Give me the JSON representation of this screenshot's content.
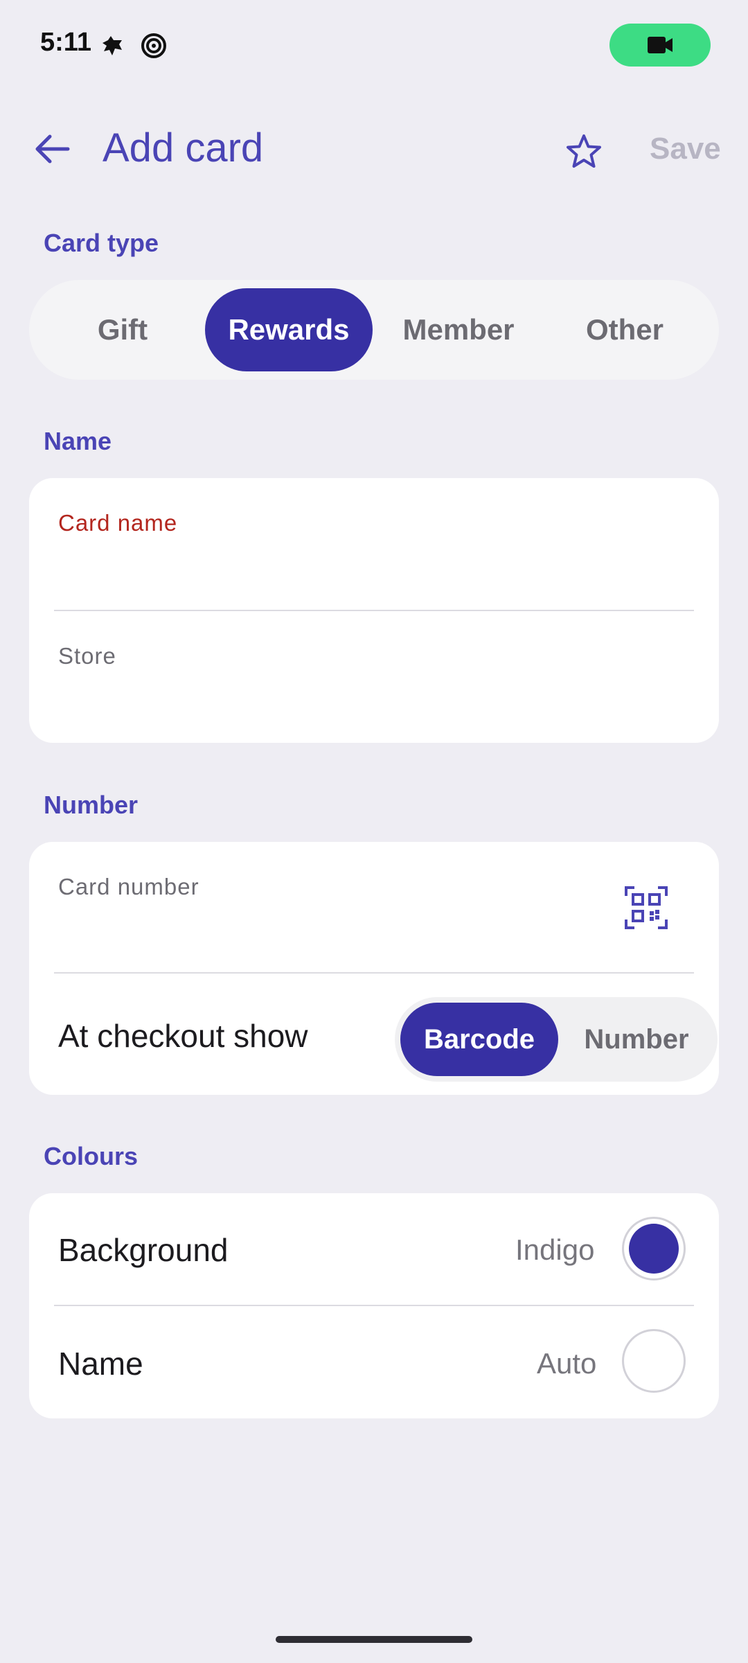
{
  "status_bar": {
    "time": "5:11"
  },
  "header": {
    "title": "Add card",
    "save_label": "Save"
  },
  "card_type": {
    "section_label": "Card type",
    "options": [
      "Gift",
      "Rewards",
      "Member",
      "Other"
    ],
    "selected": "Rewards"
  },
  "name_section": {
    "section_label": "Name",
    "card_name_label": "Card name",
    "store_label": "Store"
  },
  "number_section": {
    "section_label": "Number",
    "card_number_label": "Card number",
    "checkout_label": "At checkout show",
    "checkout_options": [
      "Barcode",
      "Number"
    ],
    "checkout_selected": "Barcode"
  },
  "colours_section": {
    "section_label": "Colours",
    "background_label": "Background",
    "background_value": "Indigo",
    "name_label": "Name",
    "name_value": "Auto"
  },
  "colors": {
    "accent": "#4a44b5",
    "selected_fill": "#3730a3",
    "error_label": "#b3261e",
    "status_video": "#3ddc84"
  }
}
